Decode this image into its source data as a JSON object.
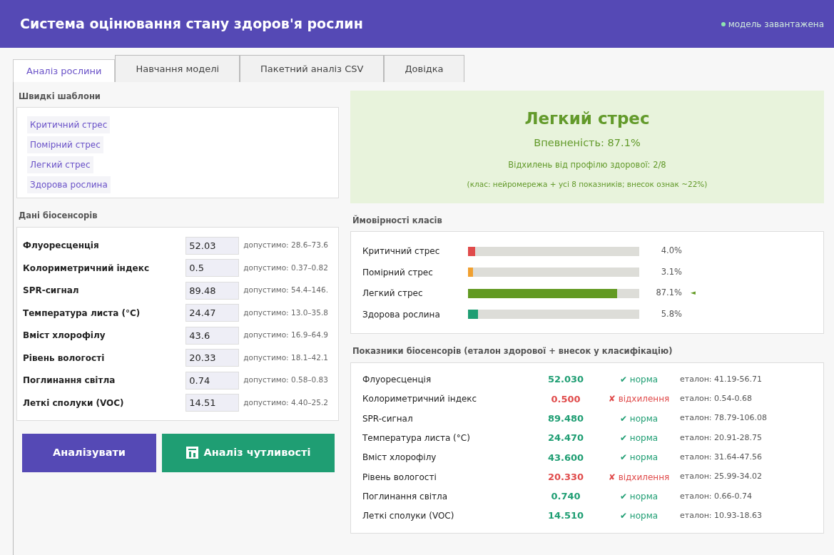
{
  "app": {
    "title": "Система оцінювання стану здоров'я рослин",
    "status": "модель завантажена"
  },
  "tabs": [
    {
      "label": "Аналіз рослини",
      "selected": true
    },
    {
      "label": "Навчання моделі",
      "selected": false
    },
    {
      "label": "Пакетний аналіз CSV",
      "selected": false
    },
    {
      "label": "Довідка",
      "selected": false
    }
  ],
  "templates": {
    "title": "Швидкі шаблони",
    "items": [
      "Критичний стрес",
      "Помірний стрес",
      "Легкий стрес",
      "Здорова рослина"
    ]
  },
  "sensors": {
    "title": "Дані біосенсорів",
    "rows": [
      {
        "label": "Флуоресценція",
        "value": "52.03",
        "hint": "допустимо: 28.6–73.6"
      },
      {
        "label": "Колориметричний індекс",
        "value": "0.5",
        "hint": "допустимо: 0.37–0.82"
      },
      {
        "label": "SPR-сигнал",
        "value": "89.48",
        "hint": "допустимо: 54.4–146."
      },
      {
        "label": "Температура листа (°C)",
        "value": "24.47",
        "hint": "допустимо: 13.0–35.8"
      },
      {
        "label": "Вміст хлорофілу",
        "value": "43.6",
        "hint": "допустимо: 16.9–64.9"
      },
      {
        "label": "Рівень вологості",
        "value": "20.33",
        "hint": "допустимо: 18.1–42.1"
      },
      {
        "label": "Поглинання світла",
        "value": "0.74",
        "hint": "допустимо: 0.58–0.83"
      },
      {
        "label": "Леткі сполуки (VOC)",
        "value": "14.51",
        "hint": "допустимо: 4.40–25.2"
      }
    ]
  },
  "buttons": [
    {
      "label": "Аналізувати",
      "kind": "primary"
    },
    {
      "label": "Аналіз чутливості",
      "kind": "chart"
    }
  ],
  "result": {
    "title": "Легкий стрес",
    "confidence": "Впевненість: 87.1%",
    "deviations": "Відхилень від профілю здорової: 2/8",
    "note": "(клас: нейромережа + усі 8 показників; внесок ознак ~22%)"
  },
  "probabilities": {
    "title": "Ймовірності класів",
    "items": [
      {
        "label": "Критичний стрес",
        "level": 0.04,
        "value": "4.0%",
        "color": "#e04b4b"
      },
      {
        "label": "Помірний стрес",
        "level": 0.031,
        "value": "3.1%",
        "color": "#f0a030"
      },
      {
        "label": "Легкий стрес",
        "level": 0.871,
        "value": "87.1%",
        "color": "#629a22",
        "pointer": "◄"
      },
      {
        "label": "Здорова рослина",
        "level": 0.058,
        "value": "5.8%",
        "color": "#1f9e73"
      }
    ]
  },
  "indicators": {
    "title": "Показники біосенсорів (еталон здорової + внесок у класифікацію)",
    "rows": [
      {
        "label": "Флуоресценція",
        "value": "52.030",
        "kind": "ok",
        "mark": "✔",
        "status": "норма",
        "ref": "еталон: 41.19-56.71"
      },
      {
        "label": "Колориметричний індекс",
        "value": "0.500",
        "kind": "deviation",
        "mark": "✘",
        "status": "відхилення",
        "ref": "еталон: 0.54-0.68"
      },
      {
        "label": "SPR-сигнал",
        "value": "89.480",
        "kind": "ok",
        "mark": "✔",
        "status": "норма",
        "ref": "еталон: 78.79-106.08"
      },
      {
        "label": "Температура листа (°C)",
        "value": "24.470",
        "kind": "ok",
        "mark": "✔",
        "status": "норма",
        "ref": "еталон: 20.91-28.75"
      },
      {
        "label": "Вміст хлорофілу",
        "value": "43.600",
        "kind": "ok",
        "mark": "✔",
        "status": "норма",
        "ref": "еталон: 31.64-47.56"
      },
      {
        "label": "Рівень вологості",
        "value": "20.330",
        "kind": "deviation",
        "mark": "✘",
        "status": "відхилення",
        "ref": "еталон: 25.99-34.02"
      },
      {
        "label": "Поглинання світла",
        "value": "0.740",
        "kind": "ok",
        "mark": "✔",
        "status": "норма",
        "ref": "еталон: 0.66-0.74"
      },
      {
        "label": "Леткі сполуки (VOC)",
        "value": "14.510",
        "kind": "ok",
        "mark": "✔",
        "status": "норма",
        "ref": "еталон: 10.93-18.63"
      }
    ]
  }
}
